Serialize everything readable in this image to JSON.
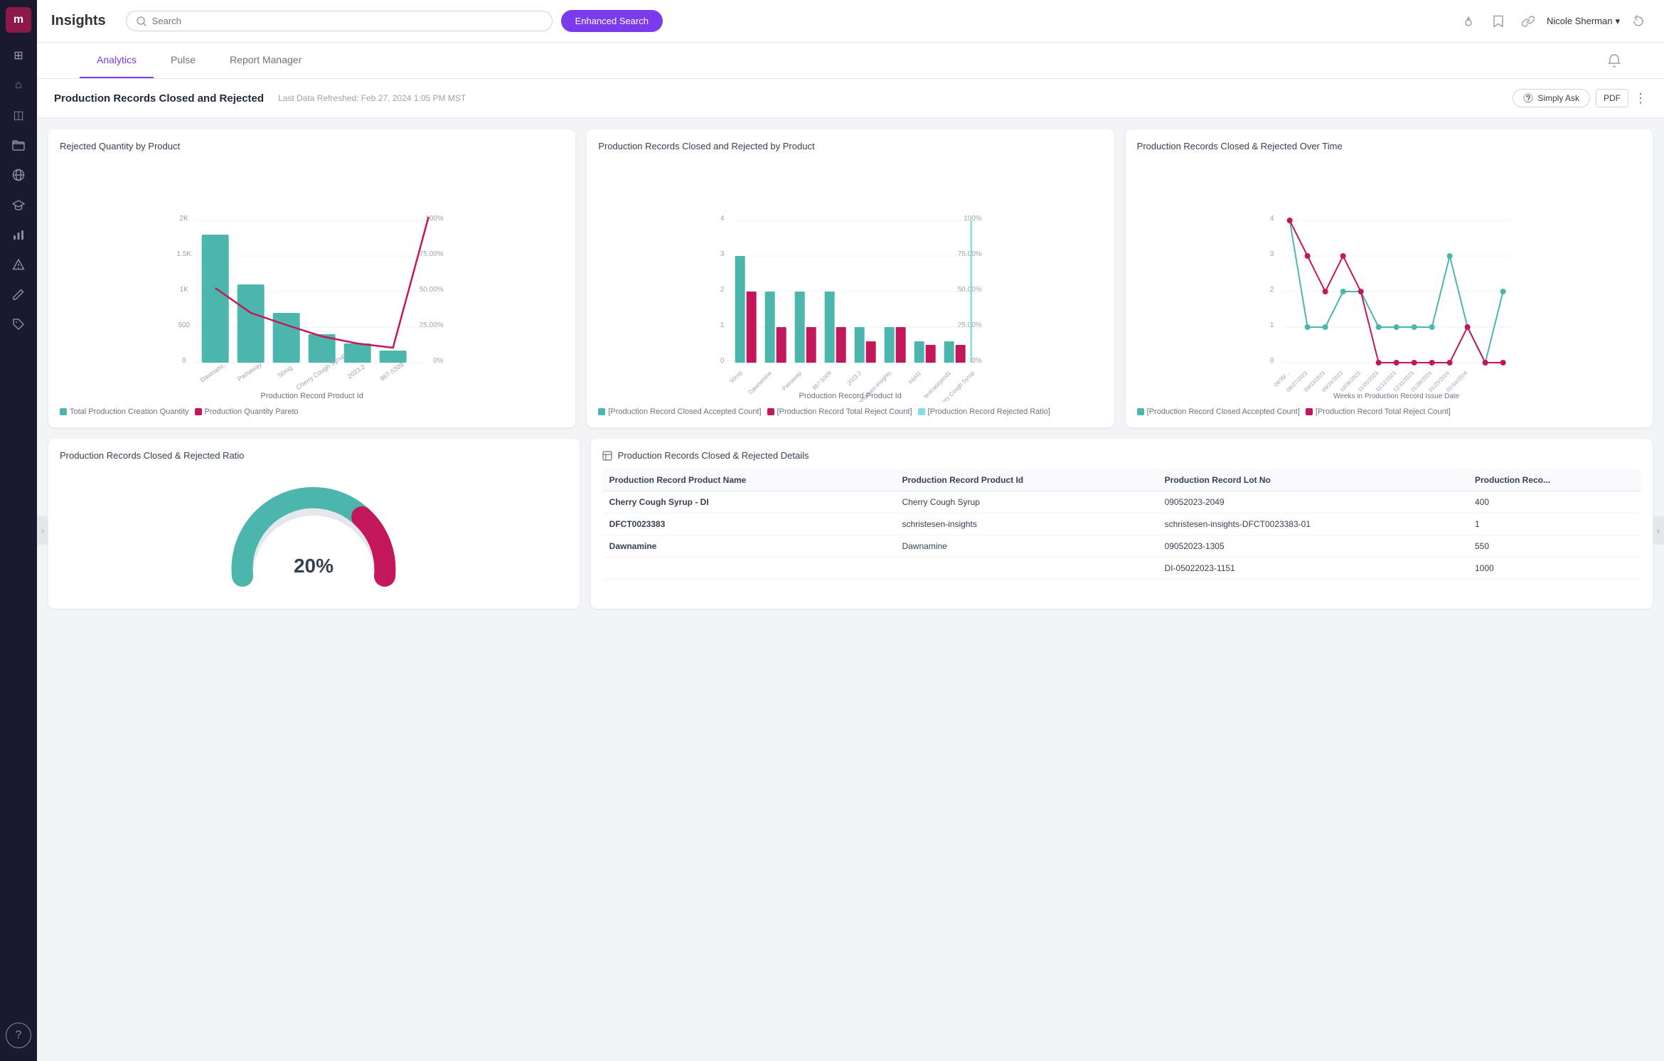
{
  "app": {
    "logo": "m",
    "title": "Insights"
  },
  "sidebar": {
    "icons": [
      {
        "name": "grid-icon",
        "symbol": "⊞",
        "active": true
      },
      {
        "name": "home-icon",
        "symbol": "⌂"
      },
      {
        "name": "layers-icon",
        "symbol": "◫"
      },
      {
        "name": "folder-icon",
        "symbol": "📁"
      },
      {
        "name": "globe-icon",
        "symbol": "⊕"
      },
      {
        "name": "education-icon",
        "symbol": "🎓"
      },
      {
        "name": "chart-icon",
        "symbol": "📊"
      },
      {
        "name": "warning-icon",
        "symbol": "⚠"
      },
      {
        "name": "edit-icon",
        "symbol": "✎"
      },
      {
        "name": "tag-icon",
        "symbol": "🏷"
      },
      {
        "name": "help-icon",
        "symbol": "?"
      }
    ]
  },
  "topbar": {
    "search_placeholder": "Search",
    "enhanced_search_label": "Enhanced Search",
    "user_name": "Nicole Sherman",
    "simply_ask_label": "Simply Ask",
    "pdf_label": "PDF"
  },
  "nav": {
    "tabs": [
      {
        "label": "Analytics",
        "active": true
      },
      {
        "label": "Pulse",
        "active": false
      },
      {
        "label": "Report Manager",
        "active": false
      }
    ]
  },
  "page": {
    "title": "Production Records Closed and Rejected",
    "refresh_info": "Last Data Refreshed: Feb 27, 2024 1:05 PM MST"
  },
  "chart1": {
    "title": "Rejected Quantity by Product",
    "x_label": "Production Record Product Id",
    "y_left_ticks": [
      "0",
      "500",
      "1K",
      "1.5K",
      "2K"
    ],
    "y_right_ticks": [
      "0%",
      "25.00%",
      "50.00%",
      "75.00%",
      "100%"
    ],
    "products": [
      "Dawnami...",
      "Painaway",
      "50mg",
      "Cherry Cough Syrup",
      "2023.2",
      "867-5309"
    ],
    "legend": [
      {
        "color": "#4db6ac",
        "label": "Total Production Creation Quantity"
      },
      {
        "color": "#c2185b",
        "label": "Production Quantity Pareto"
      }
    ]
  },
  "chart2": {
    "title": "Production Records Closed and Rejected by Product",
    "x_label": "Production Record Product Id",
    "y_left_ticks": [
      "0",
      "1",
      "2",
      "3",
      "4"
    ],
    "y_right_ticks": [
      "0%",
      "25.00%",
      "50.00%",
      "75.00%",
      "100%"
    ],
    "legend": [
      {
        "color": "#4db6ac",
        "label": "[Production Record Closed Accepted Count]"
      },
      {
        "color": "#c2185b",
        "label": "[Production Record Total Reject Count]"
      },
      {
        "color": "#80deea",
        "label": "[Production Record Rejected Ratio]"
      }
    ]
  },
  "chart3": {
    "title": "Production Records Closed & Rejected Over Time",
    "x_label": "Weeks in Production Record Issue Date",
    "y_left_ticks": [
      "0",
      "1",
      "2",
      "3",
      "4"
    ],
    "legend": [
      {
        "color": "#4db6ac",
        "label": "[Production Record Closed Accepted Count]"
      },
      {
        "color": "#c2185b",
        "label": "[Production Record Total Reject Count]"
      }
    ]
  },
  "chart4": {
    "title": "Production Records Closed & Rejected Ratio",
    "percentage": "20%"
  },
  "table": {
    "title": "Production Records Closed & Rejected Details",
    "columns": [
      "Production Record Product Name",
      "Production Record Product Id",
      "Production Record Lot No",
      "Production Reco..."
    ],
    "rows": [
      {
        "name": "Cherry Cough Syrup - DI",
        "product_id": "Cherry Cough Syrup",
        "lot_no": "09052023-2049",
        "value": "400",
        "bold": true
      },
      {
        "name": "DFCT0023383",
        "product_id": "schristesen-insights",
        "lot_no": "schristesen-insights-DFCT0023383-01",
        "value": "1",
        "bold": true
      },
      {
        "name": "Dawnamine",
        "product_id": "Dawnamine",
        "lot_no": "09052023-1305",
        "value": "550",
        "bold": true
      },
      {
        "name": "",
        "product_id": "",
        "lot_no": "DI-05022023-1151",
        "value": "1000",
        "bold": false
      }
    ]
  }
}
